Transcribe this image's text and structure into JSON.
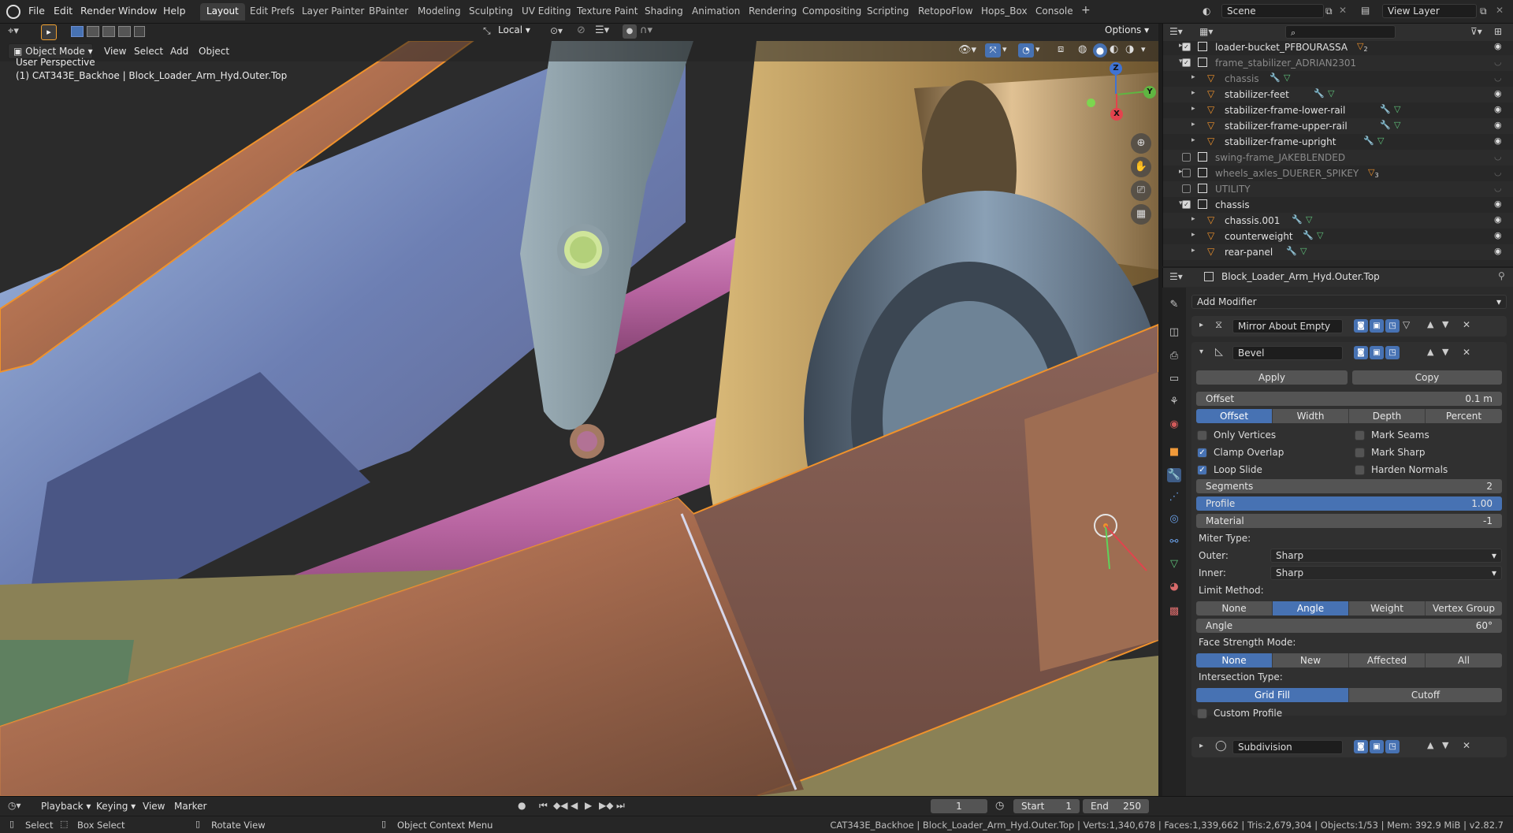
{
  "topbar": {
    "menus": [
      "File",
      "Edit",
      "Render",
      "Window",
      "Help"
    ],
    "workspaces": [
      "Layout",
      "Edit Prefs",
      "Layer Painter",
      "BPainter",
      "Modeling",
      "Sculpting",
      "UV Editing",
      "Texture Paint",
      "Shading",
      "Animation",
      "Rendering",
      "Compositing",
      "Scripting",
      "RetopoFlow",
      "Hops_Box",
      "Console"
    ],
    "active_workspace": "Layout",
    "add_tab": "+",
    "scene": "Scene",
    "view_layer": "View Layer"
  },
  "viewport": {
    "transform_orientation": "Local",
    "options_label": "Options",
    "mode": "Object Mode",
    "menus": [
      "View",
      "Select",
      "Add",
      "Object"
    ],
    "overlay_title": "User Perspective",
    "overlay_object": "(1) CAT343E_Backhoe | Block_Loader_Arm_Hyd.Outer.Top",
    "axis_labels": {
      "z": "Z",
      "y": "Y",
      "x": "X"
    }
  },
  "outliner": {
    "search_placeholder": "",
    "rows": [
      {
        "label": "loader-bucket_PFBOURASSA",
        "badge": "2",
        "dim": false
      },
      {
        "label": "frame_stabilizer_ADRIAN2301",
        "badge": "",
        "dim": true
      },
      {
        "label": "chassis",
        "badge": "",
        "dim": true
      },
      {
        "label": "stabilizer-feet",
        "badge": "",
        "dim": false
      },
      {
        "label": "stabilizer-frame-lower-rail",
        "badge": "",
        "dim": false
      },
      {
        "label": "stabilizer-frame-upper-rail",
        "badge": "",
        "dim": false
      },
      {
        "label": "stabilizer-frame-upright",
        "badge": "",
        "dim": false
      },
      {
        "label": "swing-frame_JAKEBLENDED",
        "badge": "",
        "dim": true
      },
      {
        "label": "wheels_axles_DUERER_SPIKEY",
        "badge": "3",
        "dim": true
      },
      {
        "label": "UTILITY",
        "badge": "",
        "dim": true
      },
      {
        "label": "chassis",
        "badge": "",
        "dim": false
      },
      {
        "label": "chassis.001",
        "badge": "",
        "dim": false
      },
      {
        "label": "counterweight",
        "badge": "",
        "dim": false
      },
      {
        "label": "rear-panel",
        "badge": "",
        "dim": false
      }
    ]
  },
  "properties": {
    "object_name": "Block_Loader_Arm_Hyd.Outer.Top",
    "add_modifier": "Add Modifier",
    "modifiers": {
      "mirror": "Mirror About Empty",
      "bevel": "Bevel",
      "subdivision": "Subdivision"
    },
    "bevel": {
      "apply": "Apply",
      "copy": "Copy",
      "offset_label": "Offset",
      "offset_value": "0.1 m",
      "width_types": [
        "Offset",
        "Width",
        "Depth",
        "Percent"
      ],
      "width_type_active": "Offset",
      "only_vertices": "Only Vertices",
      "mark_seams": "Mark Seams",
      "clamp_overlap": "Clamp Overlap",
      "mark_sharp": "Mark Sharp",
      "loop_slide": "Loop Slide",
      "harden_normals": "Harden Normals",
      "segments_label": "Segments",
      "segments_value": "2",
      "profile_label": "Profile",
      "profile_value": "1.00",
      "material_label": "Material",
      "material_value": "-1",
      "miter_type": "Miter Type:",
      "outer_label": "Outer:",
      "outer_value": "Sharp",
      "inner_label": "Inner:",
      "inner_value": "Sharp",
      "limit_method": "Limit Method:",
      "limit_options": [
        "None",
        "Angle",
        "Weight",
        "Vertex Group"
      ],
      "limit_active": "Angle",
      "angle_label": "Angle",
      "angle_value": "60°",
      "face_strength": "Face Strength Mode:",
      "face_options": [
        "None",
        "New",
        "Affected",
        "All"
      ],
      "face_active": "None",
      "intersection": "Intersection Type:",
      "intersection_options": [
        "Grid Fill",
        "Cutoff"
      ],
      "intersection_active": "Grid Fill",
      "custom_profile": "Custom Profile"
    }
  },
  "timeline": {
    "menus": [
      "Playback",
      "Keying",
      "View",
      "Marker"
    ],
    "current_frame": "1",
    "start_label": "Start",
    "start_value": "1",
    "end_label": "End",
    "end_value": "250"
  },
  "status": {
    "select": "Select",
    "box_select": "Box Select",
    "rotate_view": "Rotate View",
    "context_menu": "Object Context Menu",
    "stats": "CAT343E_Backhoe | Block_Loader_Arm_Hyd.Outer.Top | Verts:1,340,678 | Faces:1,339,662 | Tris:2,679,304 | Objects:1/53 | Mem: 392.9 MiB | v2.82.7"
  },
  "colors": {
    "accent": "#4772b3",
    "selection_outline": "#f0922b",
    "copper": "#b87a55",
    "pink_rod": "#c77ab6",
    "gold_block": "#c9a867"
  }
}
